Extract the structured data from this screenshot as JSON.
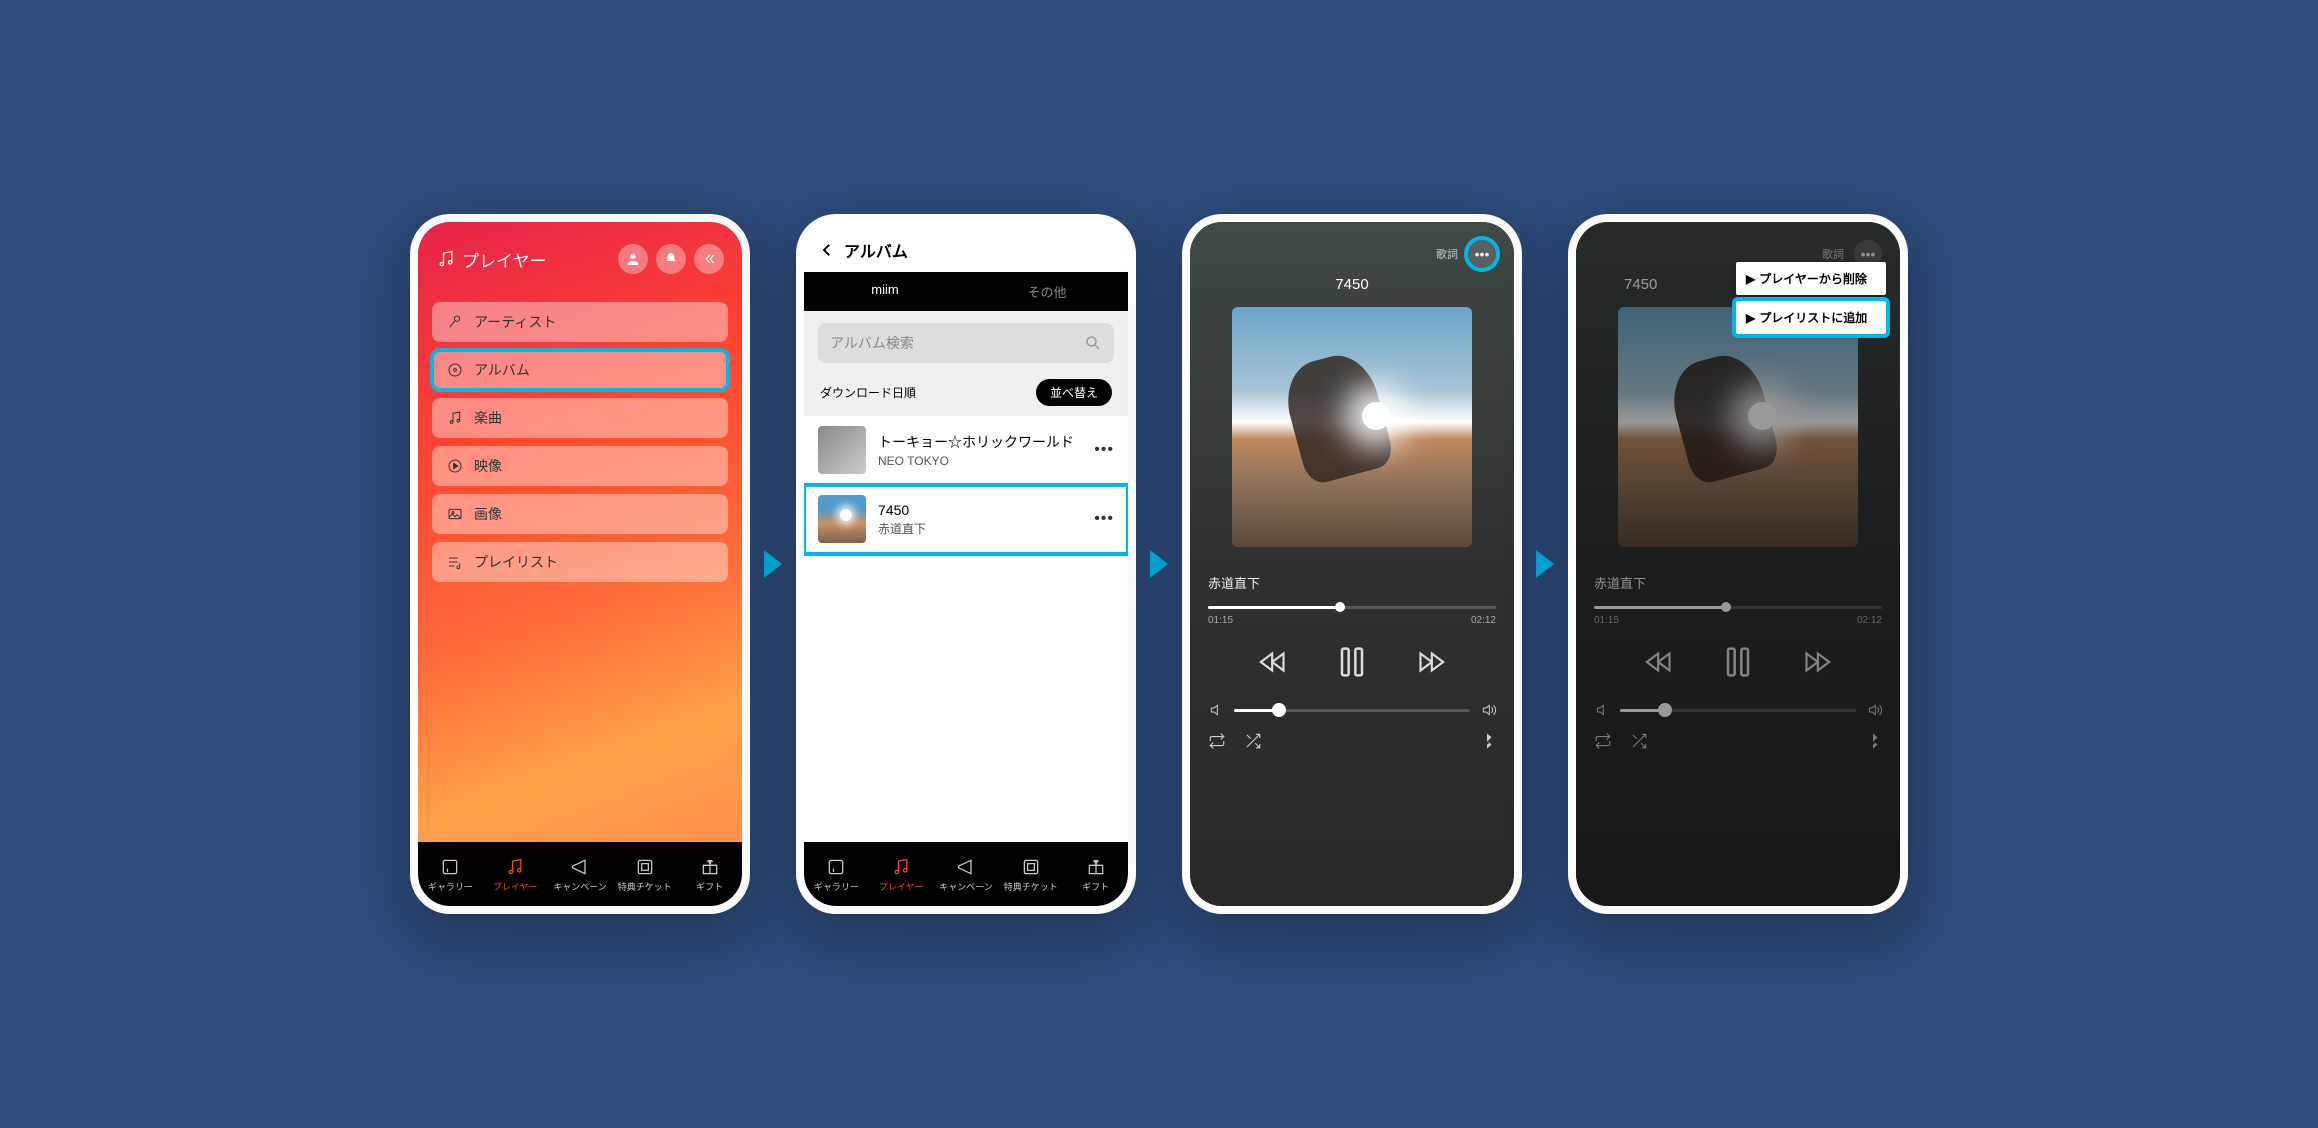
{
  "screen1": {
    "title": "プレイヤー",
    "menu": [
      {
        "label": "アーティスト",
        "icon": "mic"
      },
      {
        "label": "アルバム",
        "icon": "disc",
        "highlighted": true
      },
      {
        "label": "楽曲",
        "icon": "music"
      },
      {
        "label": "映像",
        "icon": "video"
      },
      {
        "label": "画像",
        "icon": "image"
      },
      {
        "label": "プレイリスト",
        "icon": "playlist"
      }
    ]
  },
  "screen2": {
    "back_title": "アルバム",
    "tabs": {
      "active": "miim",
      "other": "その他"
    },
    "search_placeholder": "アルバム検索",
    "sort_label": "ダウンロード日順",
    "sort_button": "並べ替え",
    "albums": [
      {
        "title": "トーキョー☆ホリックワールド",
        "artist": "NEO TOKYO"
      },
      {
        "title": "7450",
        "artist": "赤道直下",
        "highlighted": true
      }
    ]
  },
  "player": {
    "lyric_label": "歌詞",
    "title": "7450",
    "artist": "赤道直下",
    "time_elapsed": "01:15",
    "time_total": "02:12"
  },
  "dropdown": {
    "item1": "プレイヤーから削除",
    "item2": "プレイリストに追加"
  },
  "tabbar": {
    "items": [
      {
        "label": "ギャラリー"
      },
      {
        "label": "プレイヤー",
        "active": true
      },
      {
        "label": "キャンペーン"
      },
      {
        "label": "特典チケット"
      },
      {
        "label": "ギフト"
      }
    ]
  }
}
